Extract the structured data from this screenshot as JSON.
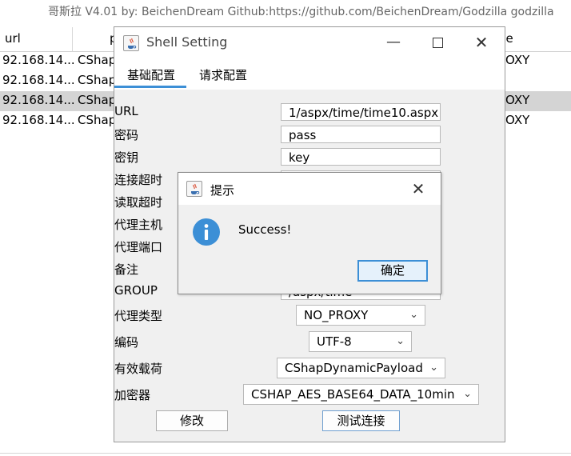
{
  "main_window": {
    "title": "哥斯拉   V4.01 by: BeichenDream Github:https://github.com/BeichenDream/Godzilla   godzilla"
  },
  "table": {
    "headers": [
      "url",
      "p",
      "pe"
    ],
    "rows": [
      {
        "url": "92.168.14...",
        "payload": "CShap",
        "type": "OXY",
        "selected": false
      },
      {
        "url": "92.168.14...",
        "payload": "CShap",
        "type": "",
        "selected": false
      },
      {
        "url": "92.168.14...",
        "payload": "CShap",
        "type": "OXY",
        "selected": true
      },
      {
        "url": "92.168.14...",
        "payload": "CShap",
        "type": "OXY",
        "selected": false
      }
    ]
  },
  "shell_dialog": {
    "title": "Shell Setting",
    "tabs": [
      "基础配置",
      "请求配置"
    ],
    "active_tab": 0,
    "labels": {
      "url": "URL",
      "password": "密码",
      "key": "密钥",
      "connect_timeout": "连接超时",
      "read_timeout": "读取超时",
      "proxy_host": "代理主机",
      "proxy_port": "代理端口",
      "remark": "备注",
      "group": "GROUP",
      "proxy_type": "代理类型",
      "encoding": "编码",
      "payload": "有效载荷",
      "cryption": "加密器"
    },
    "values": {
      "url": "1/aspx/time/time10.aspx",
      "password": "pass",
      "key": "key",
      "group": "/aspx/time",
      "proxy_type": "NO_PROXY",
      "encoding": "UTF-8",
      "payload": "CShapDynamicPayload",
      "cryption": "CSHAP_AES_BASE64_DATA_10min"
    },
    "buttons": {
      "modify": "修改",
      "test_connection": "测试连接"
    }
  },
  "alert_dialog": {
    "title": "提示",
    "message": "Success!",
    "ok_label": "确定",
    "icon": "info-icon",
    "accent_color": "#3c8fd6"
  },
  "colors": {
    "tab_underline": "#3c8fd6",
    "selected_row": "#d4d4d4",
    "dialog_bg": "#f0f0f0"
  }
}
